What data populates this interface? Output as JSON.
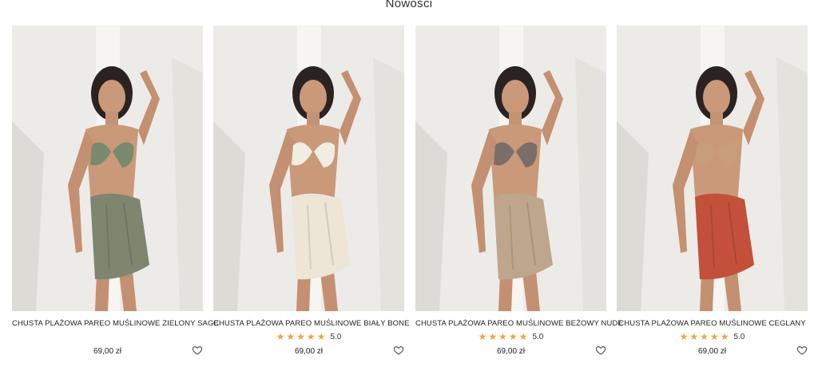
{
  "section": {
    "title": "Nowości"
  },
  "products": [
    {
      "name": "CHUSTA PLAŻOWA PAREO MUŚLINOWE ZIELONY SAGE",
      "price": "69,00 zł",
      "rating": null,
      "top_color": "#7a8a6c",
      "wrap_color": "#7f8670"
    },
    {
      "name": "CHUSTA PLAŻOWA PAREO MUŚLINOWE BIAŁY BONE",
      "price": "69,00 zł",
      "rating": "5.0",
      "top_color": "#f1ede2",
      "wrap_color": "#ede6d6"
    },
    {
      "name": "CHUSTA PLAŻOWA PAREO MUŚLINOWE BEŻOWY NUDE",
      "price": "69,00 zł",
      "rating": "5.0",
      "top_color": "#7b6d6a",
      "wrap_color": "#bda68c"
    },
    {
      "name": "CHUSTA PLAŻOWA PAREO MUŚLINOWE CEGLANY",
      "price": "69,00 zł",
      "rating": "5.0",
      "top_color": "#c89d7c",
      "wrap_color": "#c2503a"
    }
  ],
  "icons": {
    "star": "star-icon",
    "wishlist": "heart-icon"
  },
  "colors": {
    "star": "#f0a43c",
    "text": "#222222",
    "background": "#ffffff"
  }
}
